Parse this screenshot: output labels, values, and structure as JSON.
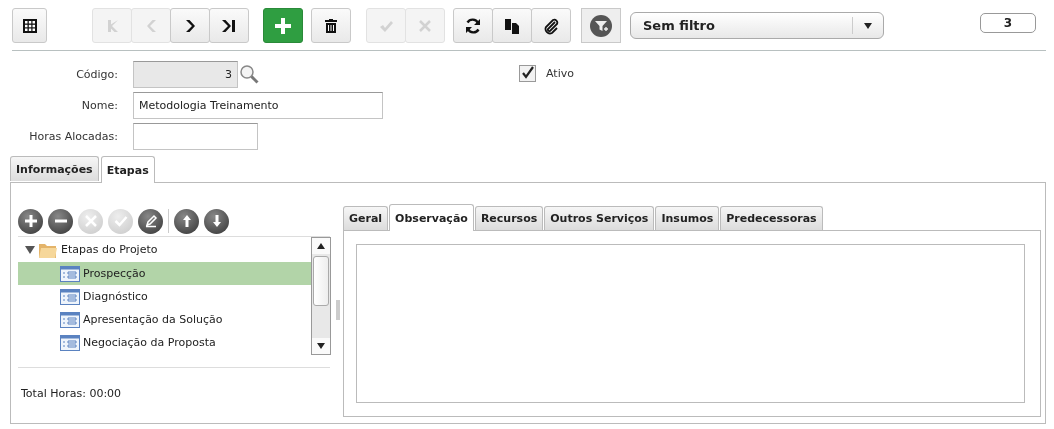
{
  "toolbar": [
    {
      "kind": "grid",
      "disabled": false
    },
    {
      "kind": "first",
      "disabled": true
    },
    {
      "kind": "prev",
      "disabled": true
    },
    {
      "kind": "next",
      "disabled": false
    },
    {
      "kind": "last",
      "disabled": false
    },
    {
      "kind": "add",
      "disabled": false
    },
    {
      "kind": "delete",
      "disabled": false
    },
    {
      "kind": "confirm",
      "disabled": true
    },
    {
      "kind": "cancel",
      "disabled": true
    },
    {
      "kind": "refresh",
      "disabled": false
    },
    {
      "kind": "copy",
      "disabled": false
    },
    {
      "kind": "attach",
      "disabled": false
    },
    {
      "kind": "filter",
      "disabled": false
    }
  ],
  "filter": {
    "value": "Sem filtro"
  },
  "record_count": "3",
  "form": {
    "codigo": {
      "label": "Código:",
      "value": "3"
    },
    "nome": {
      "label": "Nome:",
      "value": "Metodologia Treinamento"
    },
    "horas": {
      "label": "Horas Alocadas:"
    },
    "ativo": {
      "label": "Ativo",
      "checked": true
    }
  },
  "tabs": [
    {
      "label": "Informações",
      "selected": false
    },
    {
      "label": "Etapas",
      "selected": true
    }
  ],
  "tree_toolbar": [
    {
      "kind": "add",
      "disabled": false
    },
    {
      "kind": "remove",
      "disabled": false
    },
    {
      "kind": "cancel",
      "disabled": true
    },
    {
      "kind": "confirm",
      "disabled": true
    },
    {
      "kind": "edit",
      "disabled": false
    },
    {
      "kind": "up",
      "disabled": false
    },
    {
      "kind": "down",
      "disabled": false
    }
  ],
  "tree": {
    "label": "Etapas do Projeto",
    "expanded": true,
    "children": [
      {
        "label": "Prospecção",
        "selected": true
      },
      {
        "label": "Diagnóstico",
        "selected": false
      },
      {
        "label": "Apresentação da Solução",
        "selected": false
      },
      {
        "label": "Negociação da Proposta",
        "selected": false
      }
    ]
  },
  "total": "Total Horas: 00:00",
  "detail_tabs": [
    {
      "label": "Geral",
      "selected": false
    },
    {
      "label": "Observação",
      "selected": true
    },
    {
      "label": "Recursos",
      "selected": false
    },
    {
      "label": "Outros Serviços",
      "selected": false
    },
    {
      "label": "Insumos",
      "selected": false
    },
    {
      "label": "Predecessoras",
      "selected": false
    }
  ]
}
